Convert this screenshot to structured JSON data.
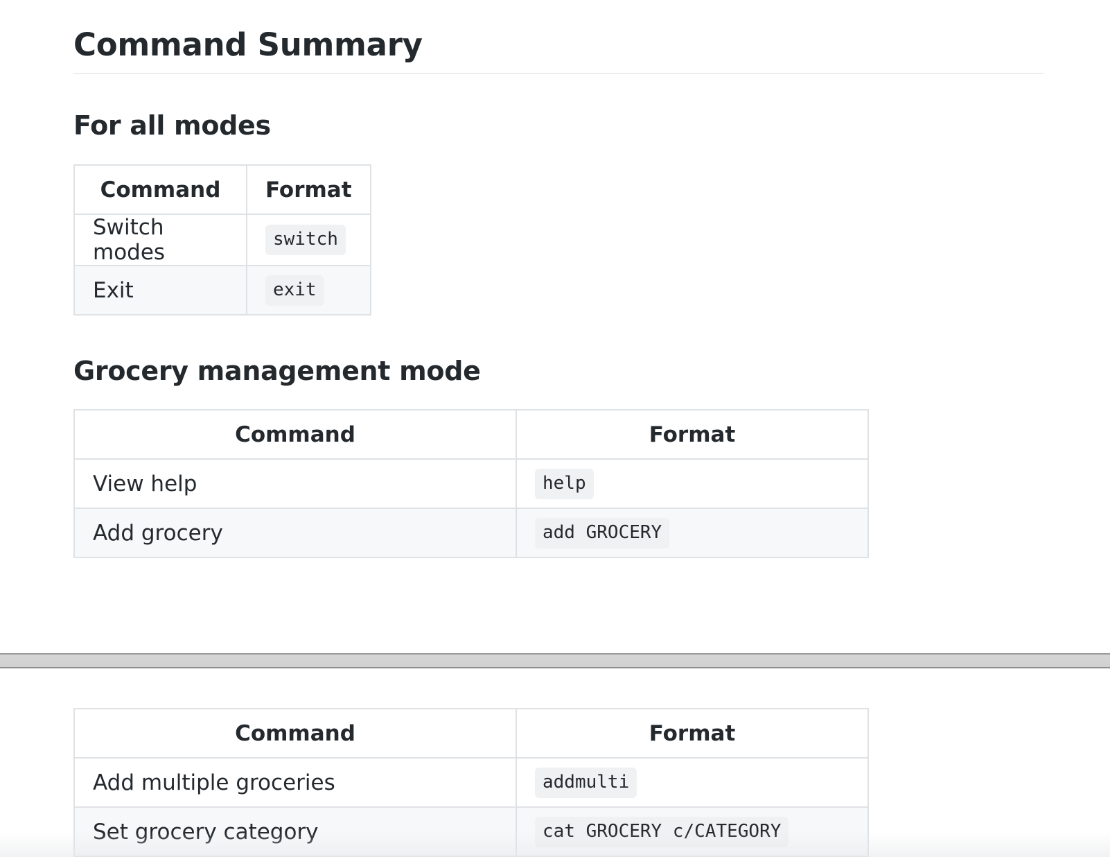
{
  "title": "Command Summary",
  "sections": [
    {
      "heading": "For all modes",
      "headers": [
        "Command",
        "Format"
      ],
      "rows": [
        {
          "command": "Switch modes",
          "format": "switch"
        },
        {
          "command": "Exit",
          "format": "exit"
        }
      ]
    },
    {
      "heading": "Grocery management mode",
      "headers": [
        "Command",
        "Format"
      ],
      "rows": [
        {
          "command": "View help",
          "format": "help"
        },
        {
          "command": "Add grocery",
          "format": "add GROCERY"
        }
      ]
    },
    {
      "heading": "",
      "headers": [
        "Command",
        "Format"
      ],
      "rows": [
        {
          "command": "Add multiple groceries",
          "format": "addmulti"
        },
        {
          "command": "Set grocery category",
          "format": "cat GROCERY c/CATEGORY"
        }
      ]
    }
  ]
}
